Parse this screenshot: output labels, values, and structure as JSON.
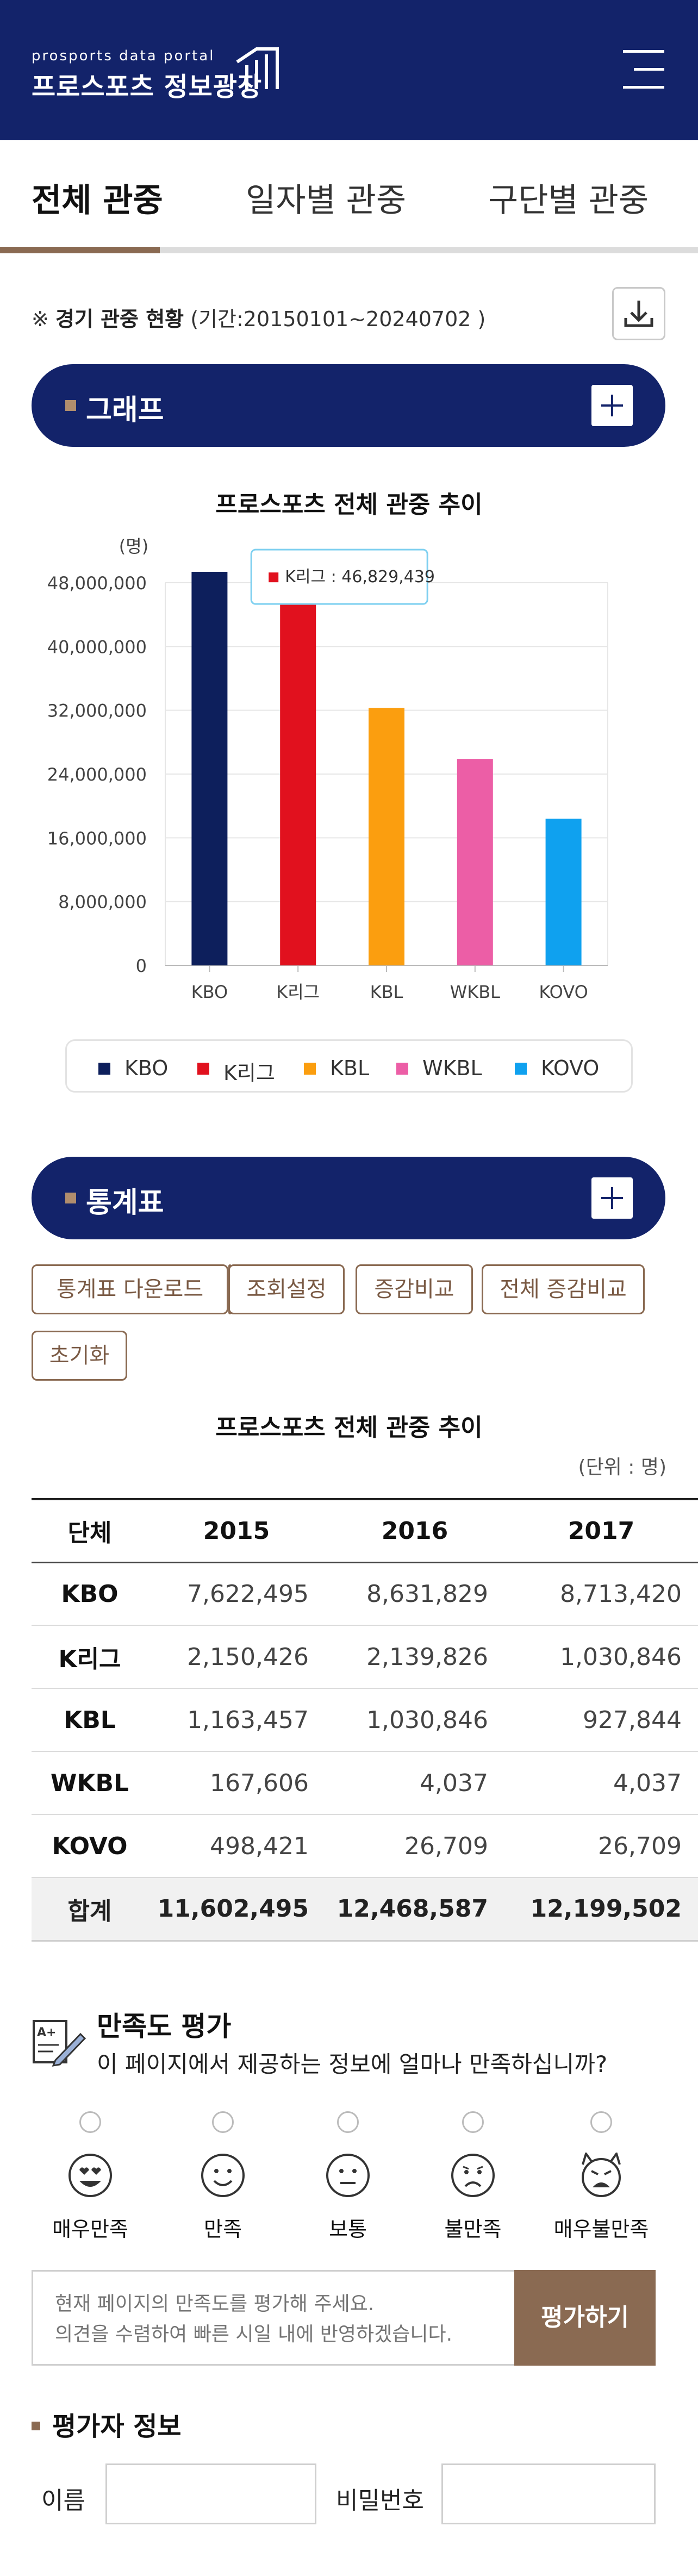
{
  "header": {
    "logo_en": "prosports data portal",
    "logo_kr": "프로스포츠 정보광장",
    "menu_icon": "hamburger-menu-icon",
    "bg_color": "#13236a"
  },
  "tabs": [
    {
      "label": "전체 관중",
      "active": true
    },
    {
      "label": "일자별 관중",
      "active": false
    },
    {
      "label": "구단별 관중",
      "active": false
    }
  ],
  "info": {
    "prefix": "※ ",
    "title": "경기 관중 현황",
    "period": " (기간:20150101~20240702 )",
    "download_icon": "download-icon"
  },
  "graph_section": {
    "title": "그래프",
    "toggle_icon": "plus-icon"
  },
  "stats_section": {
    "title": "통계표",
    "toggle_icon": "plus-icon"
  },
  "chart_data": {
    "type": "bar",
    "title": "프로스포츠 전체 관중 추이",
    "ylabel": "(명)",
    "xlabel": "",
    "categories": [
      "KBO",
      "K리그",
      "KBL",
      "WKBL",
      "KOVO"
    ],
    "values": [
      49600000,
      46829439,
      32300000,
      25900000,
      18400000
    ],
    "colors": [
      "#0d1f5c",
      "#e1111e",
      "#fb9e0f",
      "#ec5ea6",
      "#0fa1ef"
    ],
    "ylim": [
      0,
      48000000
    ],
    "yticks": [
      "0",
      "8,000,000",
      "16,000,000",
      "24,000,000",
      "32,000,000",
      "40,000,000",
      "48,000,000"
    ],
    "tooltip": {
      "category": "K리그",
      "text": "K리그 : 46,829,439",
      "color": "#e1111e"
    },
    "grid": true,
    "legend": [
      "KBO",
      "K리그",
      "KBL",
      "WKBL",
      "KOVO"
    ],
    "legend_position": "bottom"
  },
  "table_buttons": [
    "통계표 다운로드",
    "조회설정",
    "증감비교",
    "전체 증감비교",
    "초기화"
  ],
  "table": {
    "title": "프로스포츠 전체 관중 추이",
    "unit": "(단위 : 명)",
    "headers": [
      "단체",
      "2015",
      "2016",
      "2017"
    ],
    "rows": [
      [
        "KBO",
        "7,622,495",
        "8,631,829",
        "8,713,420"
      ],
      [
        "K리그",
        "2,150,426",
        "2,139,826",
        "1,030,846"
      ],
      [
        "KBL",
        "1,163,457",
        "1,030,846",
        "927,844"
      ],
      [
        "WKBL",
        "167,606",
        "4,037",
        "4,037"
      ],
      [
        "KOVO",
        "498,421",
        "26,709",
        "26,709"
      ]
    ],
    "total": [
      "합계",
      "11,602,495",
      "12,468,587",
      "12,199,502"
    ]
  },
  "satisfaction": {
    "icon": "survey-pencil-icon",
    "title": "만족도 평가",
    "question": "이 페이지에서 제공하는 정보에 얼마나 만족하십니까?",
    "ratings": [
      {
        "label": "매우만족",
        "icon": "heart-eyes-face-icon"
      },
      {
        "label": "만족",
        "icon": "smiling-face-icon"
      },
      {
        "label": "보통",
        "icon": "neutral-face-icon"
      },
      {
        "label": "불만족",
        "icon": "frowning-face-icon"
      },
      {
        "label": "매우불만족",
        "icon": "angry-devil-face-icon"
      }
    ],
    "feedback_placeholder": "현재 페이지의 만족도를 평가해 주세요.\n의견을 수렴하여 빠른 시일 내에 반영하겠습니다.",
    "submit_label": "평가하기"
  },
  "evaluator": {
    "title": "평가자 정보",
    "name_label": "이름",
    "password_label": "비밀번호",
    "name_value": "",
    "password_value": ""
  }
}
